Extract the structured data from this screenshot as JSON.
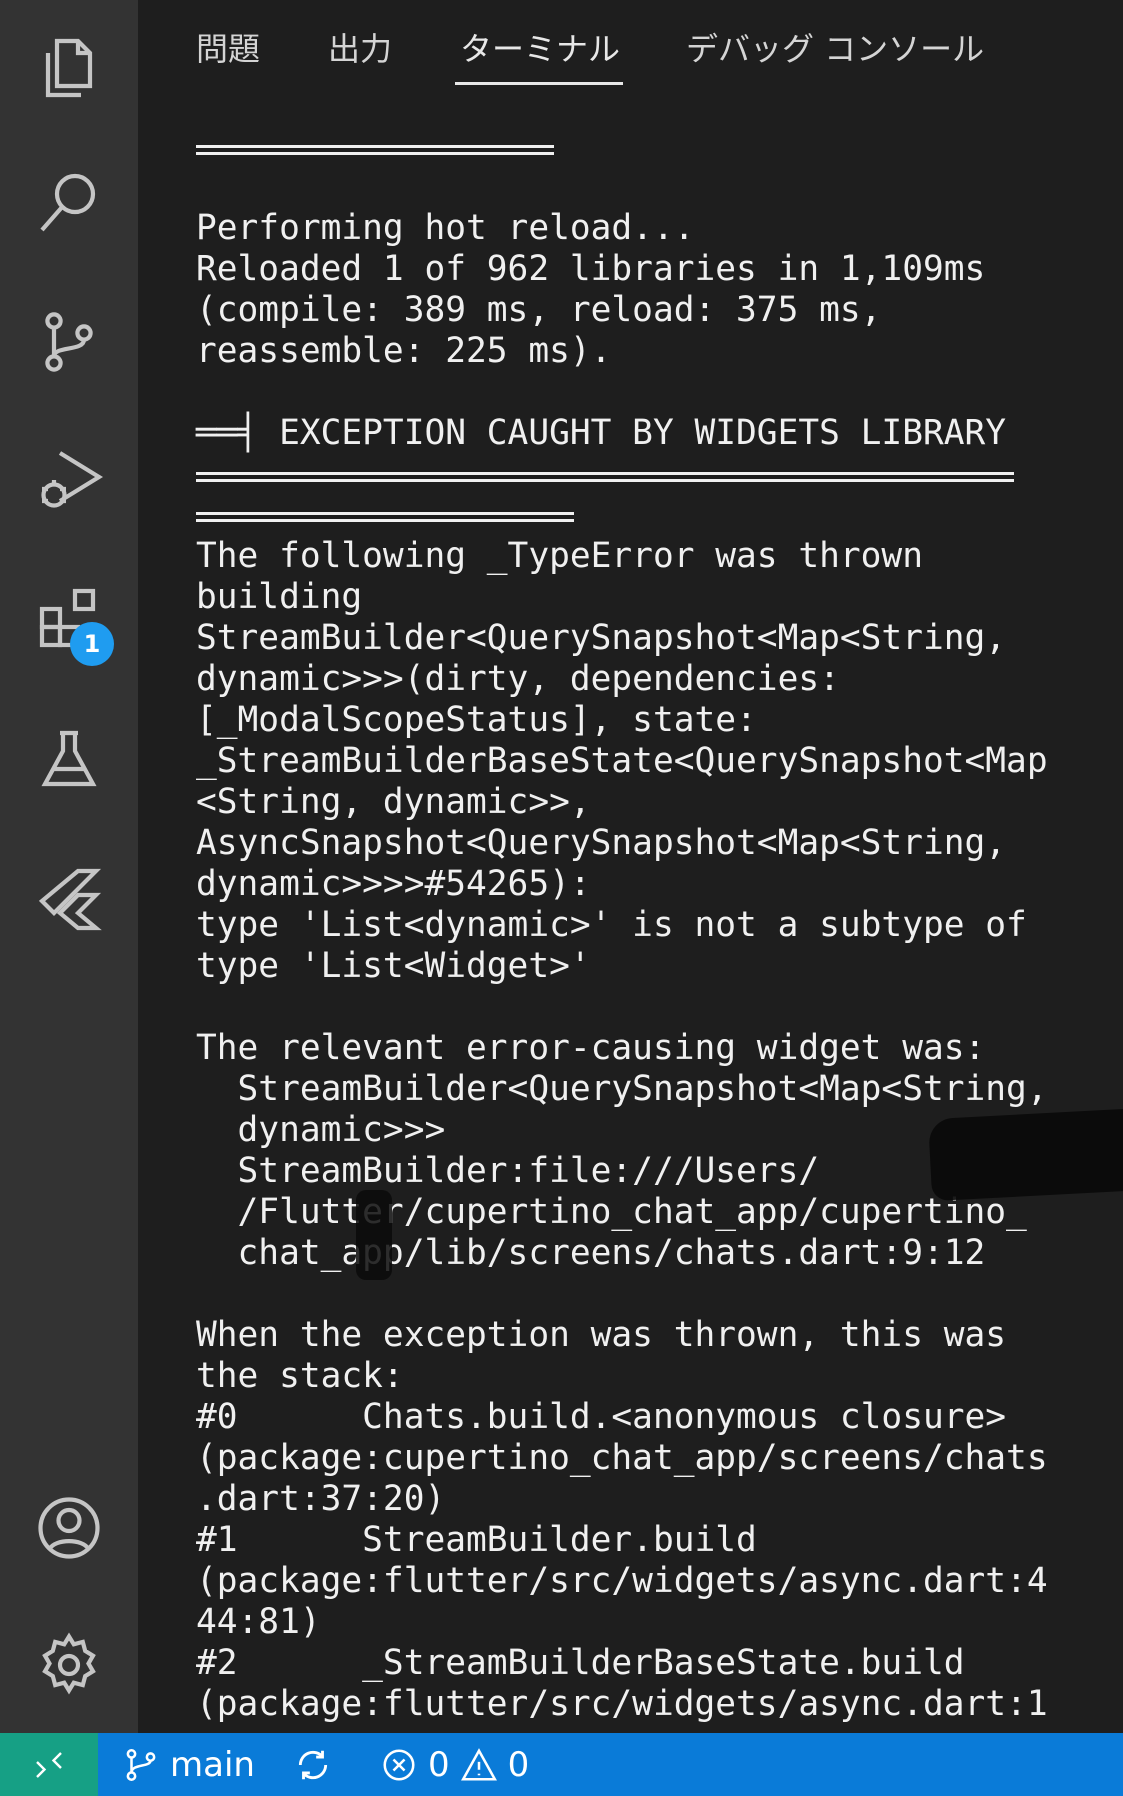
{
  "activity_bar": {
    "extensions_badge": "1"
  },
  "panel": {
    "tabs": [
      {
        "label": "問題"
      },
      {
        "label": "出力"
      },
      {
        "label": "ターミナル"
      },
      {
        "label": "デバッグ コンソール"
      }
    ],
    "active_tab": "ターミナル"
  },
  "terminal": {
    "lines": [
      "",
      "",
      "Performing hot reload...",
      "Reloaded 1 of 962 libraries in 1,109ms",
      "(compile: 389 ms, reload: 375 ms,",
      "reassemble: 225 ms).",
      "",
      "══╡ EXCEPTION CAUGHT BY WIDGETS LIBRARY",
      "",
      "",
      "The following _TypeError was thrown",
      "building",
      "StreamBuilder<QuerySnapshot<Map<String,",
      "dynamic>>>(dirty, dependencies:",
      "[_ModalScopeStatus], state:",
      "_StreamBuilderBaseState<QuerySnapshot<Map",
      "<String, dynamic>>,",
      "AsyncSnapshot<QuerySnapshot<Map<String,",
      "dynamic>>>>#54265):",
      "type 'List<dynamic>' is not a subtype of",
      "type 'List<Widget>'",
      "",
      "The relevant error-causing widget was:",
      "  StreamBuilder<QuerySnapshot<Map<String,",
      "  dynamic>>>",
      "  StreamBuilder:file:///Users/",
      "  /Flutter/cupertino_chat_app/cupertino_",
      "  chat_app/lib/screens/chats.dart:9:12",
      "",
      "When the exception was thrown, this was",
      "the stack:",
      "#0      Chats.build.<anonymous closure>",
      "(package:cupertino_chat_app/screens/chats",
      ".dart:37:20)",
      "#1      StreamBuilder.build",
      "(package:flutter/src/widgets/async.dart:4",
      "44:81)",
      "#2      _StreamBuilderBaseState.build",
      "(package:flutter/src/widgets/async.dart:1"
    ]
  },
  "statusbar": {
    "branch": "main",
    "errors": "0",
    "warnings": "0"
  },
  "colors": {
    "activity_bar_bg": "#333333",
    "panel_bg": "#1e1e1e",
    "statusbar_bg": "#0a7bd8",
    "remote_bg": "#16a085",
    "badge_bg": "#1f9cf0"
  }
}
